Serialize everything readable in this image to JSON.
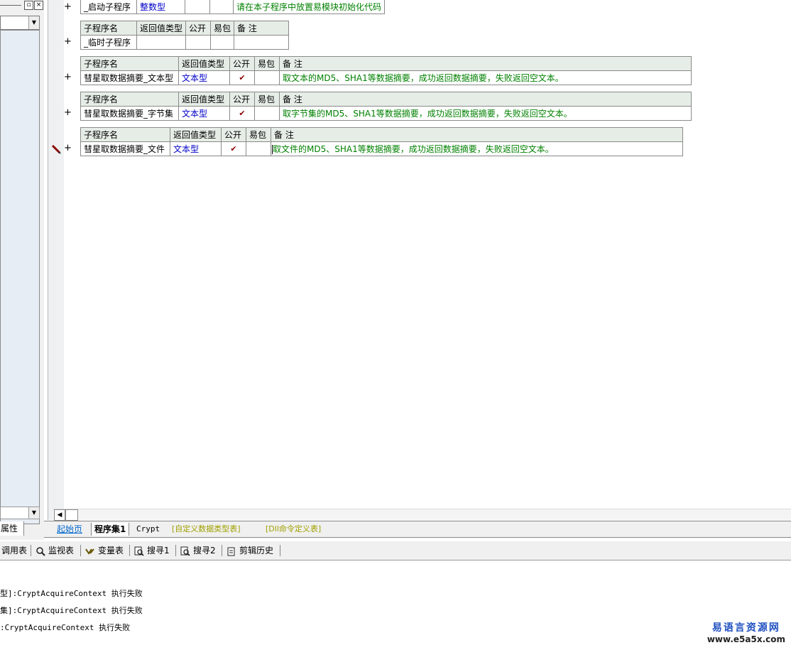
{
  "left_panel": {
    "tab_label": "属性"
  },
  "tables": [
    {
      "rows": [
        {
          "name": "_启动子程序",
          "type": "整数型",
          "public": "",
          "pack": "",
          "note": "请在本子程序中放置易模块初始化代码"
        }
      ]
    },
    {
      "headers": [
        "子程序名",
        "返回值类型",
        "公开",
        "易包",
        "备 注"
      ],
      "rows": [
        {
          "name": "_临时子程序",
          "type": "",
          "public": "",
          "pack": "",
          "note": ""
        }
      ]
    },
    {
      "headers": [
        "子程序名",
        "返回值类型",
        "公开",
        "易包",
        "备 注"
      ],
      "rows": [
        {
          "name": "彗星取数据摘要_文本型",
          "type": "文本型",
          "public": "✔",
          "pack": "",
          "note": "取文本的MD5、SHA1等数据摘要，成功返回数据摘要，失败返回空文本。"
        }
      ]
    },
    {
      "headers": [
        "子程序名",
        "返回值类型",
        "公开",
        "易包",
        "备 注"
      ],
      "rows": [
        {
          "name": "彗星取数据摘要_字节集",
          "type": "文本型",
          "public": "✔",
          "pack": "",
          "note": "取字节集的MD5、SHA1等数据摘要，成功返回数据摘要，失败返回空文本。"
        }
      ]
    },
    {
      "headers": [
        "子程序名",
        "返回值类型",
        "公开",
        "易包",
        "备 注"
      ],
      "rows": [
        {
          "name": "彗星取数据摘要_文件",
          "type": "文本型",
          "public": "✔",
          "pack": "",
          "note": "取文件的MD5、SHA1等数据摘要，成功返回数据摘要，失败返回空文本。"
        }
      ]
    }
  ],
  "gutter": {
    "expand_symbol": "+"
  },
  "tabs": [
    "起始页",
    "程序集1",
    "Crypt",
    "[自定义数据类型表]",
    "[Dll命令定义表]"
  ],
  "toolbar": [
    "调用表",
    "监视表",
    "变量表",
    "搜寻1",
    "搜寻2",
    "剪辑历史"
  ],
  "output_lines": [
    "型]:CryptAcquireContext 执行失败",
    "集]:CryptAcquireContext 执行失败",
    ":CryptAcquireContext 执行失败"
  ],
  "watermark": {
    "title": "易语言资源网",
    "url": "www.e5a5x.com"
  },
  "colors": {
    "type_blue": "#0000c8",
    "note_green": "#008000",
    "header_bg": "#e6ede6"
  }
}
